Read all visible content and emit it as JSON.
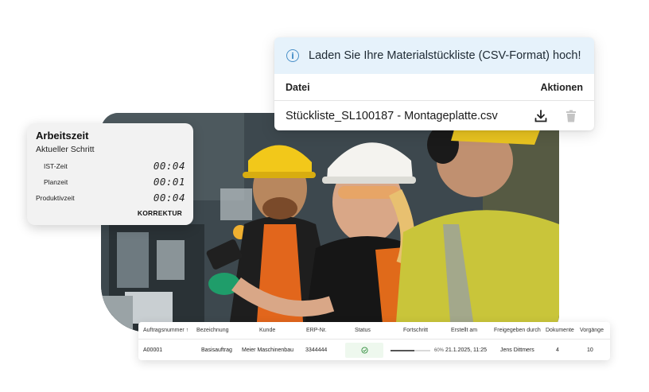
{
  "upload": {
    "info_text": "Laden Sie Ihre Materialstückliste (CSV-Format) hoch!",
    "col_file": "Datei",
    "col_actions": "Aktionen",
    "file_name": "Stückliste_SL100187 - Montageplatte.csv"
  },
  "time_card": {
    "title": "Arbeitszeit",
    "subtitle": "Aktueller Schritt",
    "rows": [
      {
        "label": "IST-Zeit",
        "value": "00:04"
      },
      {
        "label": "Planzeit",
        "value": "00:01"
      },
      {
        "label": "Produktivzeit",
        "value": "00:04"
      }
    ],
    "button": "KORREKTUR"
  },
  "table": {
    "headers": [
      "Auftragsnummer ↑",
      "Bezeichnung",
      "Kunde",
      "ERP-Nr.",
      "Status",
      "Fortschritt",
      "Erstellt am",
      "Freigegeben durch",
      "Dokumente",
      "Vorgänge"
    ],
    "row": {
      "order_no": "A00001",
      "description": "Basisauftrag",
      "customer": "Meier Maschinenbau",
      "erp": "3344444",
      "progress": 0.6,
      "progress_text": "60%",
      "created": "21.1.2025, 11:25",
      "released_by": "Jens Dittmers",
      "documents": "4",
      "operations": "10"
    }
  },
  "icons": {
    "info": "info-icon",
    "download": "download-icon",
    "delete": "trash-icon",
    "status": "check-circle-icon"
  },
  "colors": {
    "info_bg": "#e6f2fb",
    "info_icon": "#4a90c8",
    "status_ok": "#2e8b3a",
    "status_bg": "#eef8ee"
  }
}
